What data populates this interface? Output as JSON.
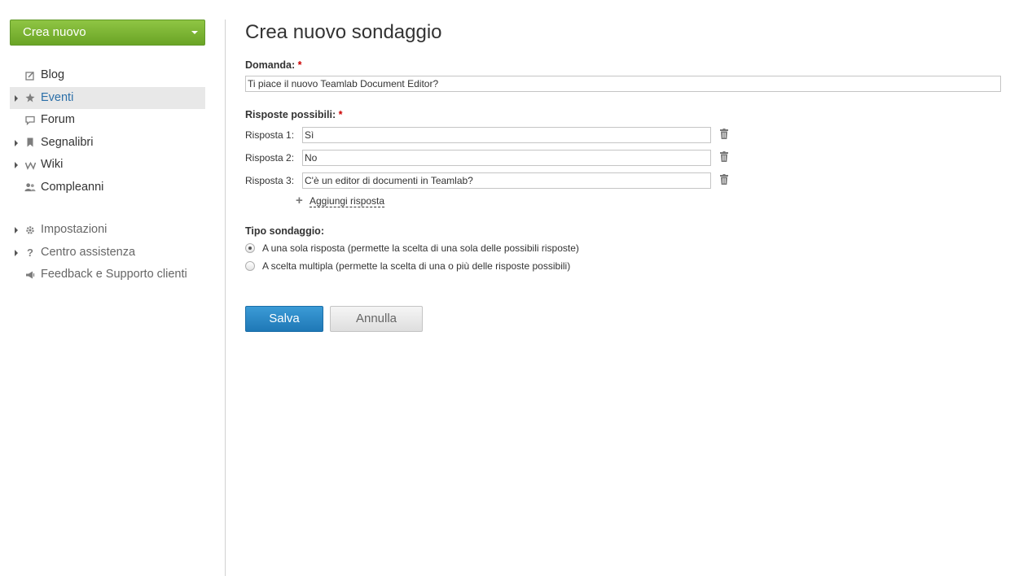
{
  "sidebar": {
    "create_button": "Crea nuovo",
    "items": [
      {
        "label": "Blog",
        "icon": "blog-icon",
        "expandable": false,
        "active": false
      },
      {
        "label": "Eventi",
        "icon": "events-icon",
        "expandable": true,
        "active": true
      },
      {
        "label": "Forum",
        "icon": "forum-icon",
        "expandable": false,
        "active": false
      },
      {
        "label": "Segnalibri",
        "icon": "bookmarks-icon",
        "expandable": true,
        "active": false
      },
      {
        "label": "Wiki",
        "icon": "wiki-icon",
        "expandable": true,
        "active": false
      },
      {
        "label": "Compleanni",
        "icon": "birthdays-icon",
        "expandable": false,
        "active": false
      }
    ],
    "items2": [
      {
        "label": "Impostazioni",
        "icon": "gear-icon",
        "expandable": true
      },
      {
        "label": "Centro assistenza",
        "icon": "help-icon",
        "expandable": true
      },
      {
        "label": "Feedback e Supporto clienti",
        "icon": "megaphone-icon",
        "expandable": false
      }
    ]
  },
  "main": {
    "title": "Crea nuovo sondaggio",
    "question_label": "Domanda:",
    "required_mark": "*",
    "question_value": "Ti piace il nuovo Teamlab Document Editor?",
    "answers_label": "Risposte possibili:",
    "answers": [
      {
        "label": "Risposta 1:",
        "value": "Sì"
      },
      {
        "label": "Risposta 2:",
        "value": "No"
      },
      {
        "label": "Risposta 3:",
        "value": "C'è un editor di documenti in Teamlab?"
      }
    ],
    "add_answer": "Aggiungi risposta",
    "type_label": "Tipo sondaggio:",
    "type_options": [
      {
        "label": "A una sola risposta (permette la scelta di una sola delle possibili risposte)",
        "checked": true
      },
      {
        "label": "A scelta multipla (permette la scelta di una o più delle risposte possibili)",
        "checked": false
      }
    ],
    "save_label": "Salva",
    "cancel_label": "Annulla"
  },
  "colors": {
    "create_button": "#7ab535",
    "save_button": "#2a88c7",
    "active_link": "#2b6fa8",
    "required": "#cc0000"
  }
}
